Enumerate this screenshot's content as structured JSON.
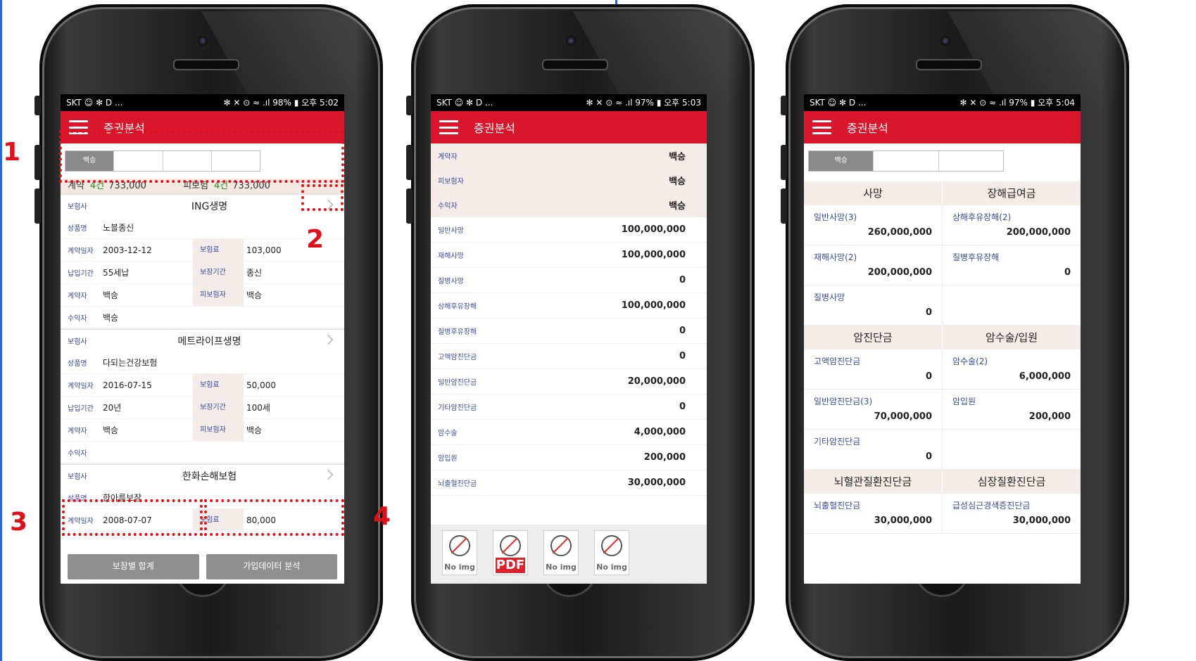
{
  "phones": [
    {
      "status": {
        "left": "SKT ☺ ✻ D ...",
        "right": "✻ ✕ ⊙ ≈ .ıl 98% ▮ 오후 5:02"
      },
      "appbar_title": "증권분석",
      "tabs": [
        "백승",
        "",
        "",
        ""
      ],
      "summary": {
        "contract_label": "계약",
        "contract_count": "4건",
        "contract_amount": "733,000",
        "insured_label": "피보험",
        "insured_count": "4건",
        "insured_amount": "733,000"
      },
      "policies": [
        {
          "insurer_label": "보험사",
          "insurer": "ING생명",
          "product_label": "상품명",
          "product": "노블종신",
          "date_label": "계약일자",
          "date": "2003-12-12",
          "premium_label": "보험료",
          "premium": "103,000",
          "pay_label": "납입기간",
          "pay": "55세납",
          "cover_label": "보장기간",
          "cover": "종신",
          "holder_label": "계약자",
          "holder": "백승",
          "insured_label": "피보험자",
          "insured": "백승",
          "beneficiary_label": "수익자",
          "beneficiary": "백승"
        },
        {
          "insurer_label": "보험사",
          "insurer": "메트라이프생명",
          "product_label": "상품명",
          "product": "다되는건강보험",
          "date_label": "계약일자",
          "date": "2016-07-15",
          "premium_label": "보험료",
          "premium": "50,000",
          "pay_label": "납입기간",
          "pay": "20년",
          "cover_label": "보장기간",
          "cover": "100세",
          "holder_label": "계약자",
          "holder": "백승",
          "insured_label": "피보험자",
          "insured": "백승",
          "beneficiary_label": "수익자",
          "beneficiary": ""
        },
        {
          "insurer_label": "보험사",
          "insurer": "한화손해보험",
          "product_label": "상품명",
          "product": "한아름보장",
          "date_label": "계약일자",
          "date": "2008-07-07",
          "premium_label": "보험료",
          "premium": "80,000"
        }
      ],
      "buttons": {
        "sum": "보장별 합계",
        "analysis": "가입데이터 분석"
      }
    },
    {
      "status": {
        "left": "SKT ☺ ✻ D ...",
        "right": "✻ ✕ ⊙ ≈ .ıl 97% ▮ 오후 5:03"
      },
      "appbar_title": "증권분석",
      "parties": [
        {
          "label": "계약자",
          "value": "백승"
        },
        {
          "label": "피보험자",
          "value": "백승"
        },
        {
          "label": "수익자",
          "value": "백승"
        }
      ],
      "coverages": [
        {
          "label": "일반사망",
          "value": "100,000,000"
        },
        {
          "label": "재해사망",
          "value": "100,000,000"
        },
        {
          "label": "질병사망",
          "value": "0"
        },
        {
          "label": "상해후유장해",
          "value": "100,000,000"
        },
        {
          "label": "질병후유장해",
          "value": "0"
        },
        {
          "label": "고액암진단금",
          "value": "0"
        },
        {
          "label": "일반암진단금",
          "value": "20,000,000"
        },
        {
          "label": "기타암진단금",
          "value": "0"
        },
        {
          "label": "암수술",
          "value": "4,000,000"
        },
        {
          "label": "암입원",
          "value": "200,000"
        },
        {
          "label": "뇌출혈진단금",
          "value": "30,000,000"
        }
      ],
      "images": [
        "No img",
        "PDF",
        "No img",
        "No img"
      ]
    },
    {
      "status": {
        "left": "SKT ☺ ✻ D ...",
        "right": "✻ ✕ ⊙ ≈ .ıl 97% ▮ 오후 5:04"
      },
      "appbar_title": "증권분석",
      "tabs": [
        "백승",
        "",
        "",
        ""
      ],
      "sections": [
        {
          "headers": [
            "사망",
            "장해급여금"
          ],
          "left": [
            {
              "name": "일반사망(3)",
              "amount": "260,000,000"
            },
            {
              "name": "재해사망(2)",
              "amount": "200,000,000"
            },
            {
              "name": "질병사망",
              "amount": "0"
            }
          ],
          "right": [
            {
              "name": "상해후유장해(2)",
              "amount": "200,000,000"
            },
            {
              "name": "질병후유장해",
              "amount": "0"
            },
            {
              "name": "",
              "amount": ""
            }
          ]
        },
        {
          "headers": [
            "암진단금",
            "암수술/입원"
          ],
          "left": [
            {
              "name": "고액암진단금",
              "amount": "0"
            },
            {
              "name": "일반암진단금(3)",
              "amount": "70,000,000"
            },
            {
              "name": "기타암진단금",
              "amount": "0"
            }
          ],
          "right": [
            {
              "name": "암수술(2)",
              "amount": "6,000,000"
            },
            {
              "name": "암입원",
              "amount": "200,000"
            },
            {
              "name": "",
              "amount": ""
            }
          ]
        },
        {
          "headers": [
            "뇌혈관질환진단금",
            "심장질환진단금"
          ],
          "left": [
            {
              "name": "뇌출혈진단금",
              "amount": "30,000,000"
            }
          ],
          "right": [
            {
              "name": "급성심근경색증진단금",
              "amount": "30,000,000"
            }
          ]
        }
      ]
    }
  ],
  "callouts": [
    "1",
    "2",
    "3",
    "4"
  ],
  "colors": {
    "brand_red": "#d9162c",
    "highlight_red": "#e0101a",
    "label_blue": "#3b4a9c",
    "beige": "#f3ece8",
    "accent_blue": "#1e6bd6"
  }
}
